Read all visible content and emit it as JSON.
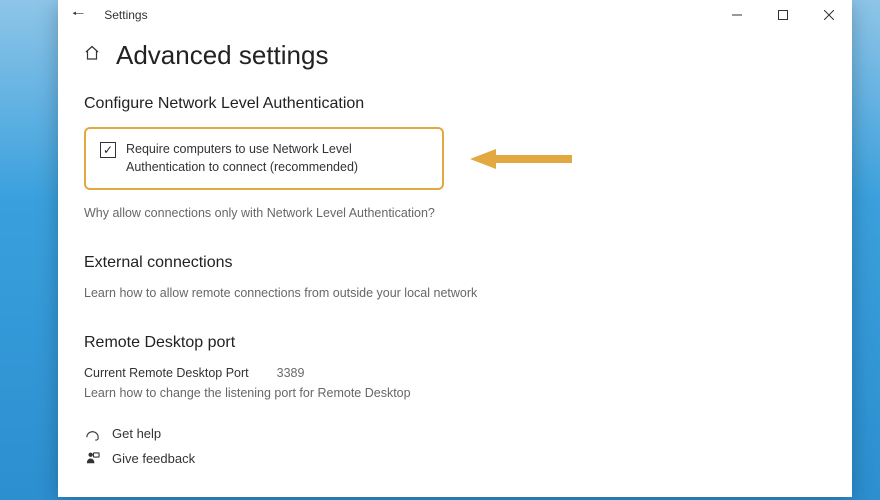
{
  "window": {
    "title": "Settings"
  },
  "page": {
    "title": "Advanced settings"
  },
  "nla": {
    "heading": "Configure Network Level Authentication",
    "checkbox_label": "Require computers to use Network Level Authentication to connect (recommended)",
    "why_link": "Why allow connections only with Network Level Authentication?"
  },
  "external": {
    "heading": "External connections",
    "text": "Learn how to allow remote connections from outside your local network"
  },
  "port": {
    "heading": "Remote Desktop port",
    "current_label": "Current Remote Desktop Port",
    "current_value": "3389",
    "learn_text": "Learn how to change the listening port for Remote Desktop"
  },
  "footer": {
    "get_help": "Get help",
    "give_feedback": "Give feedback"
  }
}
